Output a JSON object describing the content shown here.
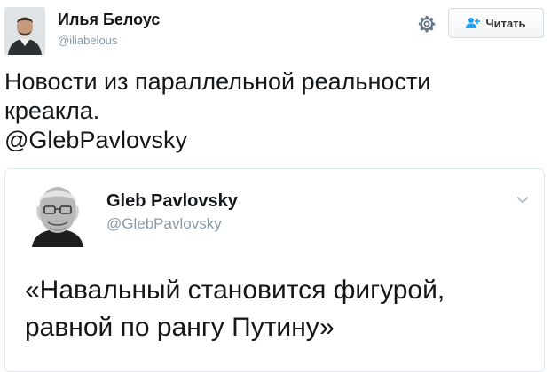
{
  "tweet": {
    "author": {
      "name": "Илья Белоус",
      "handle": "@iliabelous"
    },
    "follow_label": "Читать",
    "text_lines": [
      "Новости из параллельной реальности",
      "креакла."
    ],
    "mention": "@GlebPavlovsky",
    "quoted": {
      "author_name": "Gleb Pavlovsky",
      "author_handle": "@GlebPavlovsky",
      "text_lines": [
        "«Навальный становится фигурой,",
        "равной по рангу Путину»"
      ]
    }
  },
  "icons": {
    "settings": "gear-icon",
    "follow": "follow-user-icon",
    "menu": "chevron-down-icon"
  },
  "colors": {
    "text": "#14171a",
    "secondary_text": "#8899a6",
    "border": "#e1e8ed",
    "follow_icon": "#1da1f2"
  }
}
